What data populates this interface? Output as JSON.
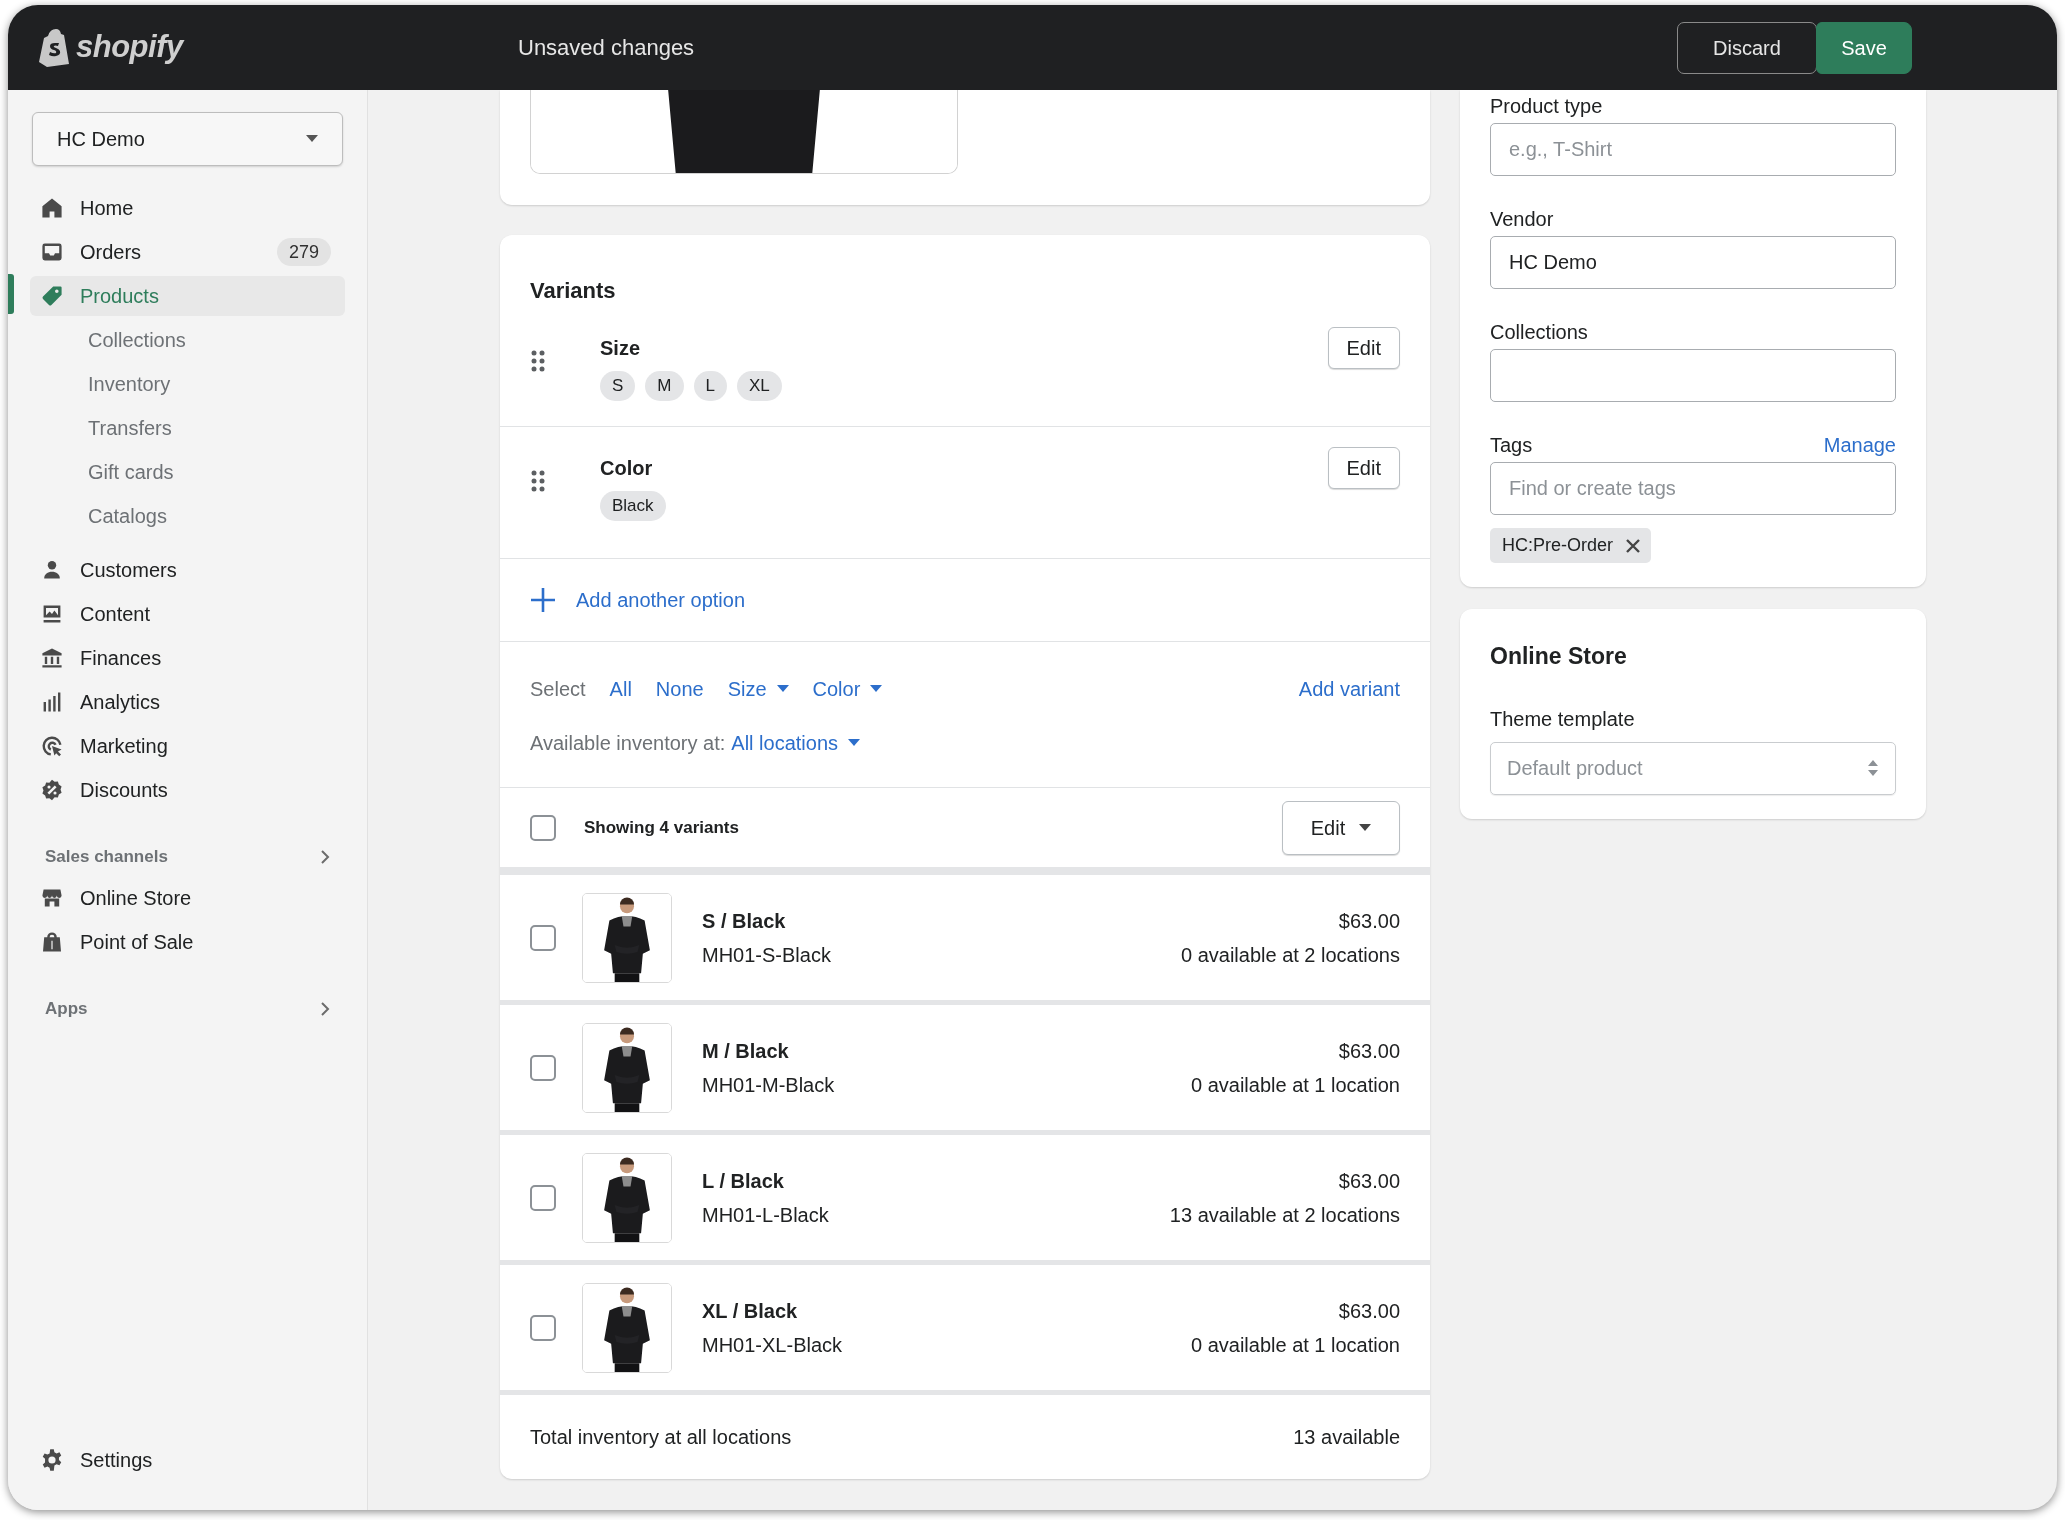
{
  "topbar": {
    "brand": "shopify",
    "title": "Unsaved changes",
    "buttons": [
      {
        "label": "Discard",
        "kind": "secondary"
      },
      {
        "label": "Save",
        "kind": "primary"
      }
    ]
  },
  "sidebar": {
    "store": "HC Demo",
    "nav": [
      {
        "label": "Home",
        "selected": false
      },
      {
        "label": "Orders",
        "badge": "279",
        "selected": false
      },
      {
        "label": "Products",
        "selected": true,
        "children": [
          {
            "label": "Collections",
            "selected": false
          },
          {
            "label": "Inventory",
            "selected": false
          },
          {
            "label": "Transfers",
            "selected": false
          },
          {
            "label": "Gift cards",
            "selected": false
          },
          {
            "label": "Catalogs",
            "selected": false
          }
        ]
      },
      {
        "label": "Customers",
        "selected": false
      },
      {
        "label": "Content",
        "selected": false
      },
      {
        "label": "Finances",
        "selected": false
      },
      {
        "label": "Analytics",
        "selected": false
      },
      {
        "label": "Marketing",
        "selected": false
      },
      {
        "label": "Discounts",
        "selected": false
      }
    ],
    "sections": [
      {
        "title": "Sales channels",
        "items": [
          {
            "label": "Online Store",
            "selected": false
          },
          {
            "label": "Point of Sale",
            "selected": false
          }
        ]
      },
      {
        "title": "Apps"
      }
    ],
    "settings": "Settings"
  },
  "variants": {
    "title": "Variants",
    "options": [
      {
        "name": "Size",
        "values": [
          "S",
          "M",
          "L",
          "XL"
        ],
        "button": "Edit"
      },
      {
        "name": "Color",
        "values": [
          "Black"
        ],
        "button": "Edit"
      }
    ],
    "add_option": "Add another option",
    "select": {
      "label": "Select",
      "links": [
        {
          "label": "All",
          "dropdown": false
        },
        {
          "label": "None",
          "dropdown": false
        },
        {
          "label": "Size",
          "dropdown": true
        },
        {
          "label": "Color",
          "dropdown": true
        }
      ],
      "add_variant": "Add variant"
    },
    "inventory": {
      "label": "Available inventory at:",
      "value": "All locations"
    },
    "bulk": {
      "checked": false,
      "label": "Showing 4 variants",
      "button": "Edit"
    },
    "rows": [
      {
        "checked": false,
        "title": "S / Black",
        "sku": "MH01-S-Black",
        "price": "$63.00",
        "availability": "0 available at 2 locations"
      },
      {
        "checked": false,
        "title": "M / Black",
        "sku": "MH01-M-Black",
        "price": "$63.00",
        "availability": "0 available at 1 location"
      },
      {
        "checked": false,
        "title": "L / Black",
        "sku": "MH01-L-Black",
        "price": "$63.00",
        "availability": "13 available at 2 locations"
      },
      {
        "checked": false,
        "title": "XL / Black",
        "sku": "MH01-XL-Black",
        "price": "$63.00",
        "availability": "0 available at 1 location"
      }
    ],
    "total": {
      "label": "Total inventory at all locations",
      "value": "13 available"
    }
  },
  "organization": {
    "fields": [
      {
        "label": "Product type",
        "placeholder": "e.g., T-Shirt"
      },
      {
        "label": "Vendor",
        "value": "HC Demo"
      },
      {
        "label": "Collections"
      },
      {
        "label": "Tags",
        "action": "Manage",
        "placeholder": "Find or create tags",
        "tags": [
          "HC:Pre-Order"
        ]
      }
    ]
  },
  "online_store": {
    "title": "Online Store",
    "field": {
      "label": "Theme template",
      "placeholder": "Default product"
    }
  }
}
